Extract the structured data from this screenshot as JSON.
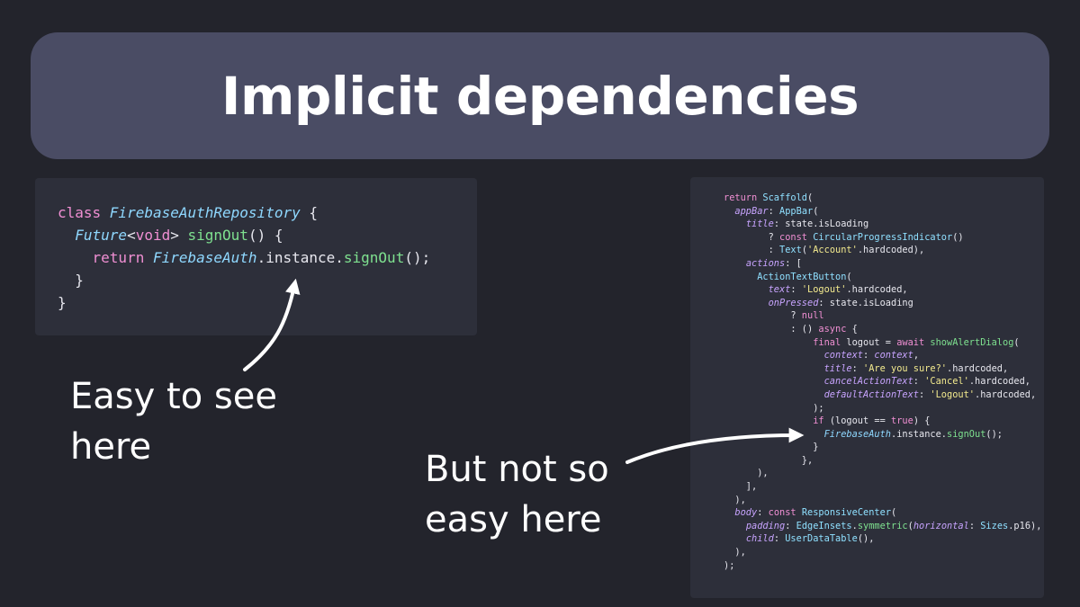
{
  "title": "Implicit dependencies",
  "left_callout": {
    "line1": "Easy to see",
    "line2": "here"
  },
  "right_callout": {
    "line1": "But not so",
    "line2": "easy here"
  },
  "left_code": [
    [
      [
        "k",
        "class "
      ],
      [
        "t",
        "FirebaseAuthRepository"
      ],
      [
        "o",
        " {"
      ]
    ],
    [
      [
        "o",
        "  "
      ],
      [
        "t",
        "Future"
      ],
      [
        "o",
        "<"
      ],
      [
        "k",
        "void"
      ],
      [
        "o",
        "> "
      ],
      [
        "f",
        "signOut"
      ],
      [
        "o",
        "() {"
      ]
    ],
    [
      [
        "o",
        "    "
      ],
      [
        "k",
        "return "
      ],
      [
        "t",
        "FirebaseAuth"
      ],
      [
        "o",
        ".instance."
      ],
      [
        "f",
        "signOut"
      ],
      [
        "o",
        "();"
      ]
    ],
    [
      [
        "o",
        "  }"
      ]
    ],
    [
      [
        "o",
        "}"
      ]
    ]
  ],
  "right_code": [
    [
      [
        "k",
        "return "
      ],
      [
        "c",
        "Scaffold"
      ],
      [
        "o",
        "("
      ]
    ],
    [
      [
        "o",
        "  "
      ],
      [
        "p",
        "appBar"
      ],
      [
        "o",
        ": "
      ],
      [
        "c",
        "AppBar"
      ],
      [
        "o",
        "("
      ]
    ],
    [
      [
        "o",
        "    "
      ],
      [
        "p",
        "title"
      ],
      [
        "o",
        ": state.isLoading"
      ]
    ],
    [
      [
        "o",
        "        ? "
      ],
      [
        "k",
        "const "
      ],
      [
        "c",
        "CircularProgressIndicator"
      ],
      [
        "o",
        "()"
      ]
    ],
    [
      [
        "o",
        "        : "
      ],
      [
        "c",
        "Text"
      ],
      [
        "o",
        "("
      ],
      [
        "s",
        "'Account'"
      ],
      [
        "o",
        ".hardcoded),"
      ]
    ],
    [
      [
        "o",
        "    "
      ],
      [
        "p",
        "actions"
      ],
      [
        "o",
        ": ["
      ]
    ],
    [
      [
        "o",
        "      "
      ],
      [
        "c",
        "ActionTextButton"
      ],
      [
        "o",
        "("
      ]
    ],
    [
      [
        "o",
        "        "
      ],
      [
        "p",
        "text"
      ],
      [
        "o",
        ": "
      ],
      [
        "s",
        "'Logout'"
      ],
      [
        "o",
        ".hardcoded,"
      ]
    ],
    [
      [
        "o",
        "        "
      ],
      [
        "p",
        "onPressed"
      ],
      [
        "o",
        ": state.isLoading"
      ]
    ],
    [
      [
        "o",
        "            ? "
      ],
      [
        "k",
        "null"
      ]
    ],
    [
      [
        "o",
        "            : () "
      ],
      [
        "k",
        "async"
      ],
      [
        "o",
        " {"
      ]
    ],
    [
      [
        "o",
        "                "
      ],
      [
        "k",
        "final "
      ],
      [
        "o",
        "logout = "
      ],
      [
        "k",
        "await "
      ],
      [
        "f",
        "showAlertDialog"
      ],
      [
        "o",
        "("
      ]
    ],
    [
      [
        "o",
        "                  "
      ],
      [
        "p",
        "context"
      ],
      [
        "o",
        ": "
      ],
      [
        "p",
        "context"
      ],
      [
        "o",
        ","
      ]
    ],
    [
      [
        "o",
        "                  "
      ],
      [
        "p",
        "title"
      ],
      [
        "o",
        ": "
      ],
      [
        "s",
        "'Are you sure?'"
      ],
      [
        "o",
        ".hardcoded,"
      ]
    ],
    [
      [
        "o",
        "                  "
      ],
      [
        "p",
        "cancelActionText"
      ],
      [
        "o",
        ": "
      ],
      [
        "s",
        "'Cancel'"
      ],
      [
        "o",
        ".hardcoded,"
      ]
    ],
    [
      [
        "o",
        "                  "
      ],
      [
        "p",
        "defaultActionText"
      ],
      [
        "o",
        ": "
      ],
      [
        "s",
        "'Logout'"
      ],
      [
        "o",
        ".hardcoded,"
      ]
    ],
    [
      [
        "o",
        "                );"
      ]
    ],
    [
      [
        "o",
        "                "
      ],
      [
        "k",
        "if "
      ],
      [
        "o",
        "(logout == "
      ],
      [
        "k",
        "true"
      ],
      [
        "o",
        ") {"
      ]
    ],
    [
      [
        "o",
        "                  "
      ],
      [
        "t",
        "FirebaseAuth"
      ],
      [
        "o",
        ".instance."
      ],
      [
        "f",
        "signOut"
      ],
      [
        "o",
        "();"
      ]
    ],
    [
      [
        "o",
        "                }"
      ]
    ],
    [
      [
        "o",
        "              },"
      ]
    ],
    [
      [
        "o",
        "      ),"
      ]
    ],
    [
      [
        "o",
        "    ],"
      ]
    ],
    [
      [
        "o",
        "  ),"
      ]
    ],
    [
      [
        "o",
        "  "
      ],
      [
        "p",
        "body"
      ],
      [
        "o",
        ": "
      ],
      [
        "k",
        "const "
      ],
      [
        "c",
        "ResponsiveCenter"
      ],
      [
        "o",
        "("
      ]
    ],
    [
      [
        "o",
        "    "
      ],
      [
        "p",
        "padding"
      ],
      [
        "o",
        ": "
      ],
      [
        "c",
        "EdgeInsets"
      ],
      [
        "o",
        "."
      ],
      [
        "f",
        "symmetric"
      ],
      [
        "o",
        "("
      ],
      [
        "p",
        "horizontal"
      ],
      [
        "o",
        ": "
      ],
      [
        "c",
        "Sizes"
      ],
      [
        "o",
        ".p16),"
      ]
    ],
    [
      [
        "o",
        "    "
      ],
      [
        "p",
        "child"
      ],
      [
        "o",
        ": "
      ],
      [
        "c",
        "UserDataTable"
      ],
      [
        "o",
        "(),"
      ]
    ],
    [
      [
        "o",
        "  ),"
      ]
    ],
    [
      [
        "o",
        ");"
      ]
    ]
  ]
}
